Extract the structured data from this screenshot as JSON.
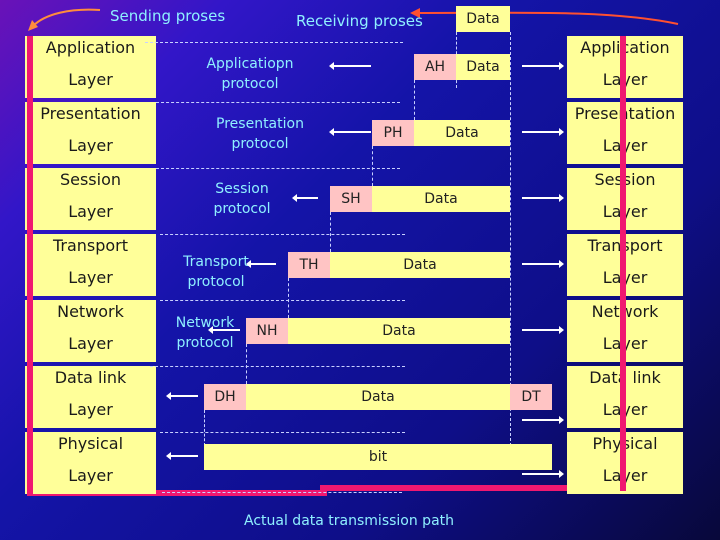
{
  "titles": {
    "sending": "Sending proses",
    "receiving": "Receiving proses",
    "top_data": "Data",
    "footer": "Actual data transmission path"
  },
  "layers": [
    {
      "line1": "Application",
      "line2": "Layer"
    },
    {
      "line1": "Presentation",
      "line2": "Layer"
    },
    {
      "line1": "Session",
      "line2": "Layer"
    },
    {
      "line1": "Transport",
      "line2": "Layer"
    },
    {
      "line1": "Network",
      "line2": "Layer"
    },
    {
      "line1": "Data link",
      "line2": "Layer"
    },
    {
      "line1": "Physical",
      "line2": "Layer"
    }
  ],
  "protocols": [
    {
      "line1": "Applicatiopn",
      "line2": "protocol"
    },
    {
      "line1": "Presentation",
      "line2": "protocol"
    },
    {
      "line1": "Session",
      "line2": "protocol"
    },
    {
      "line1": "Transport",
      "line2": "protocol"
    },
    {
      "line1": "Network",
      "line2": "protocol"
    }
  ],
  "units": [
    {
      "header": "AH",
      "data": "Data"
    },
    {
      "header": "PH",
      "data": "Data"
    },
    {
      "header": "SH",
      "data": "Data"
    },
    {
      "header": "TH",
      "data": "Data"
    },
    {
      "header": "NH",
      "data": "Data"
    },
    {
      "header": "DH",
      "data": "Data",
      "trailer": "DT"
    },
    {
      "data": "bit"
    }
  ],
  "colors": {
    "layer_box": "#ffff99",
    "header_box": "#ffc4c4",
    "path_line": "#f01870",
    "label_text": "#8ff0ff",
    "curve_arrow_left": "#ff8c3c",
    "curve_arrow_right": "#ff5030"
  }
}
